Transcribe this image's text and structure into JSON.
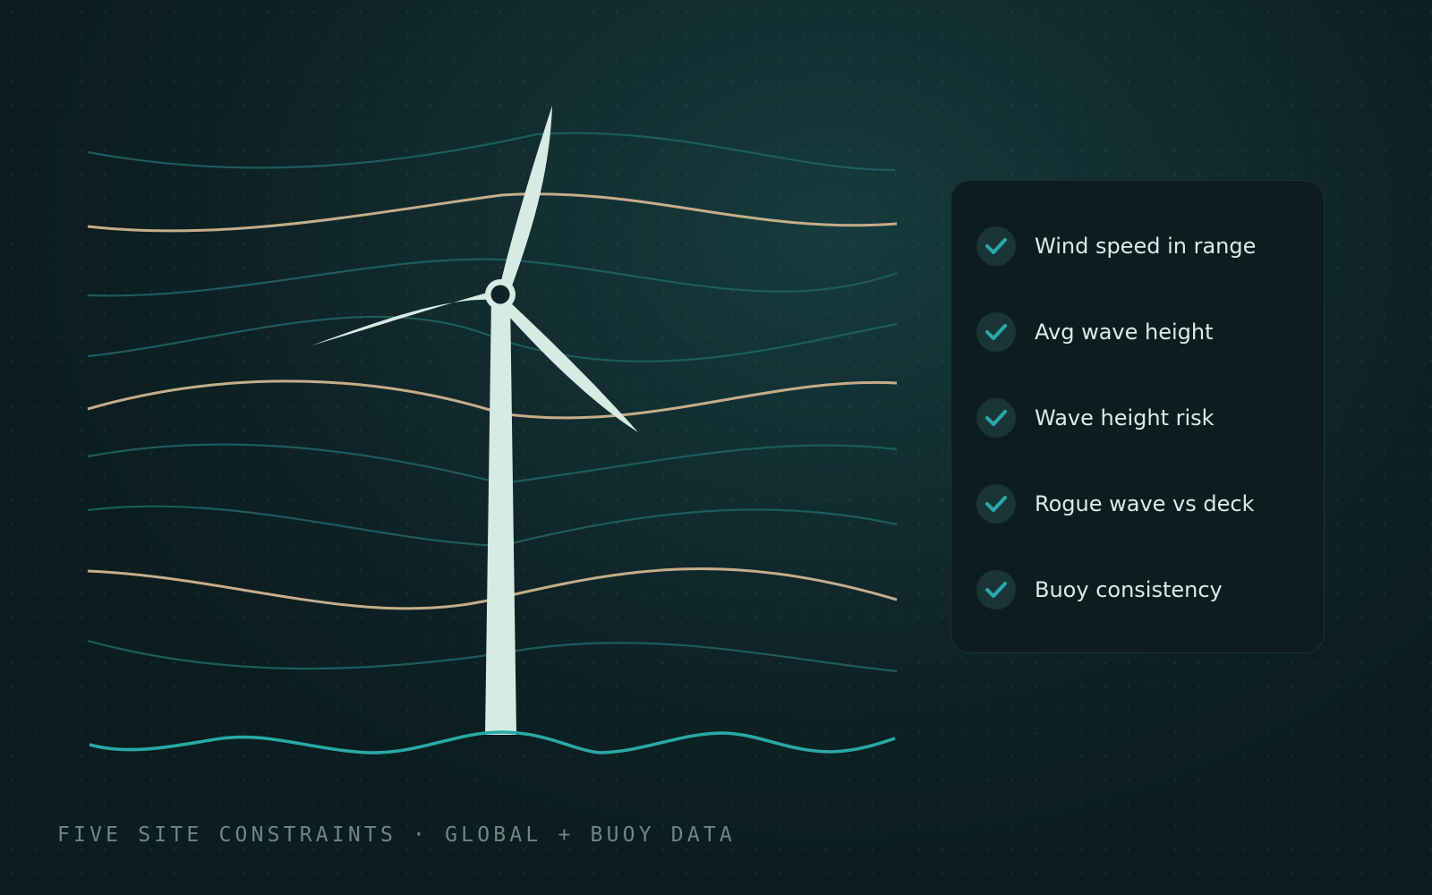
{
  "checklist": {
    "items": [
      {
        "label": "Wind speed in range",
        "status": "checked"
      },
      {
        "label": "Avg wave height",
        "status": "checked"
      },
      {
        "label": "Wave height risk",
        "status": "checked"
      },
      {
        "label": "Rogue wave vs deck",
        "status": "checked"
      },
      {
        "label": "Buoy consistency",
        "status": "checked"
      }
    ]
  },
  "footer": {
    "caption": "FIVE SITE CONSTRAINTS · GLOBAL + BUOY DATA"
  },
  "illustration": {
    "subject": "wind-turbine-over-waves",
    "icon_set": [
      "check-icon",
      "wind-turbine-icon",
      "wave-line"
    ]
  },
  "colors": {
    "background": "#112c2f",
    "card": "#0e1c20",
    "accent_teal": "#2aa8a8",
    "wave_tan": "#c6ad8a",
    "wave_dark": "#1d5c5e",
    "turbine": "#d5ebe4",
    "text": "#d9ebe6",
    "caption": "#6f8784"
  }
}
